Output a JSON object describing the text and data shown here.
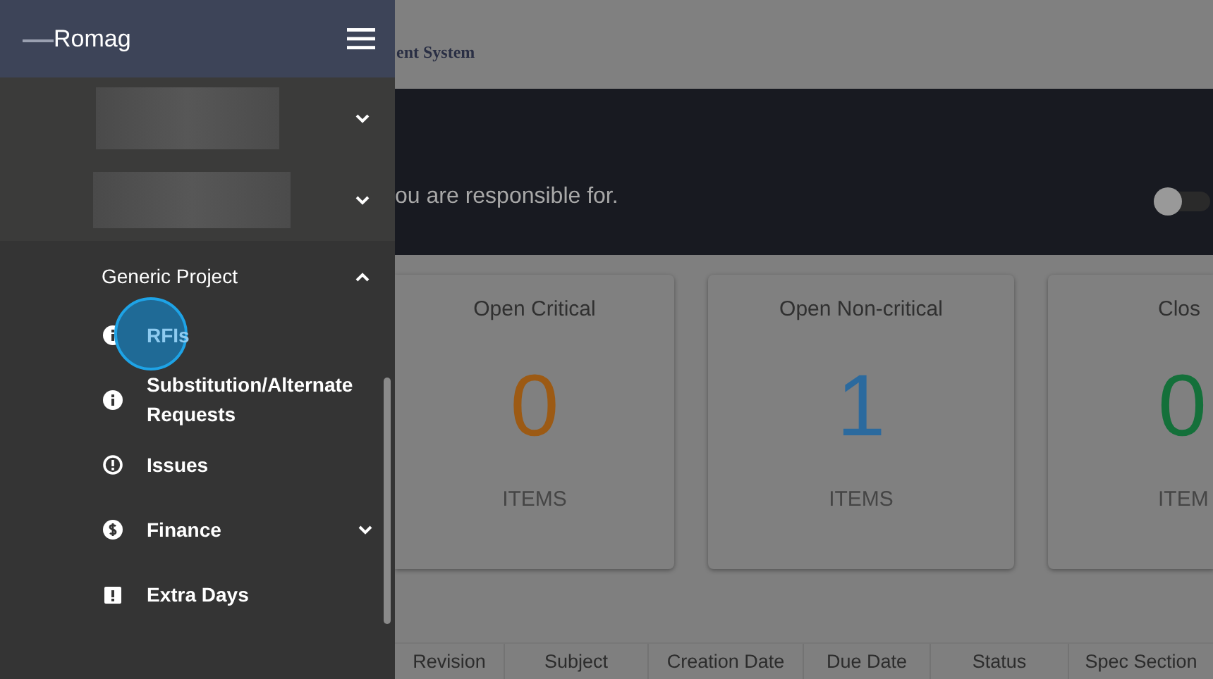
{
  "header": {
    "title": "ent System"
  },
  "banner": {
    "text": "ou are responsible for.",
    "toggle": {
      "on": false
    }
  },
  "cards": [
    {
      "title": "Open Critical",
      "value": "0",
      "unit": "ITEMS",
      "color": "#9c5a14"
    },
    {
      "title": "Open Non-critical",
      "value": "1",
      "unit": "ITEMS",
      "color": "#2b6a9e"
    },
    {
      "title": "Clos",
      "value": "0",
      "unit": "ITEM",
      "color": "#14703a"
    }
  ],
  "table": {
    "columns": [
      "Revision",
      "Subject",
      "Creation Date",
      "Due Date",
      "Status",
      "Spec Section"
    ]
  },
  "sidebar": {
    "brand": "Romag",
    "groups": [
      {
        "kind": "redacted",
        "expanded": false
      },
      {
        "kind": "redacted",
        "expanded": false
      },
      {
        "kind": "group",
        "label": "Generic Project",
        "expanded": true,
        "items": [
          {
            "label": "RFIs",
            "selected": true
          },
          {
            "label": "Substitution/Alternate Requests",
            "selected": false
          },
          {
            "label": "Issues",
            "selected": false
          },
          {
            "label": "Finance",
            "selected": false,
            "expanded": false
          },
          {
            "label": "Extra Days",
            "selected": false
          }
        ]
      }
    ]
  }
}
